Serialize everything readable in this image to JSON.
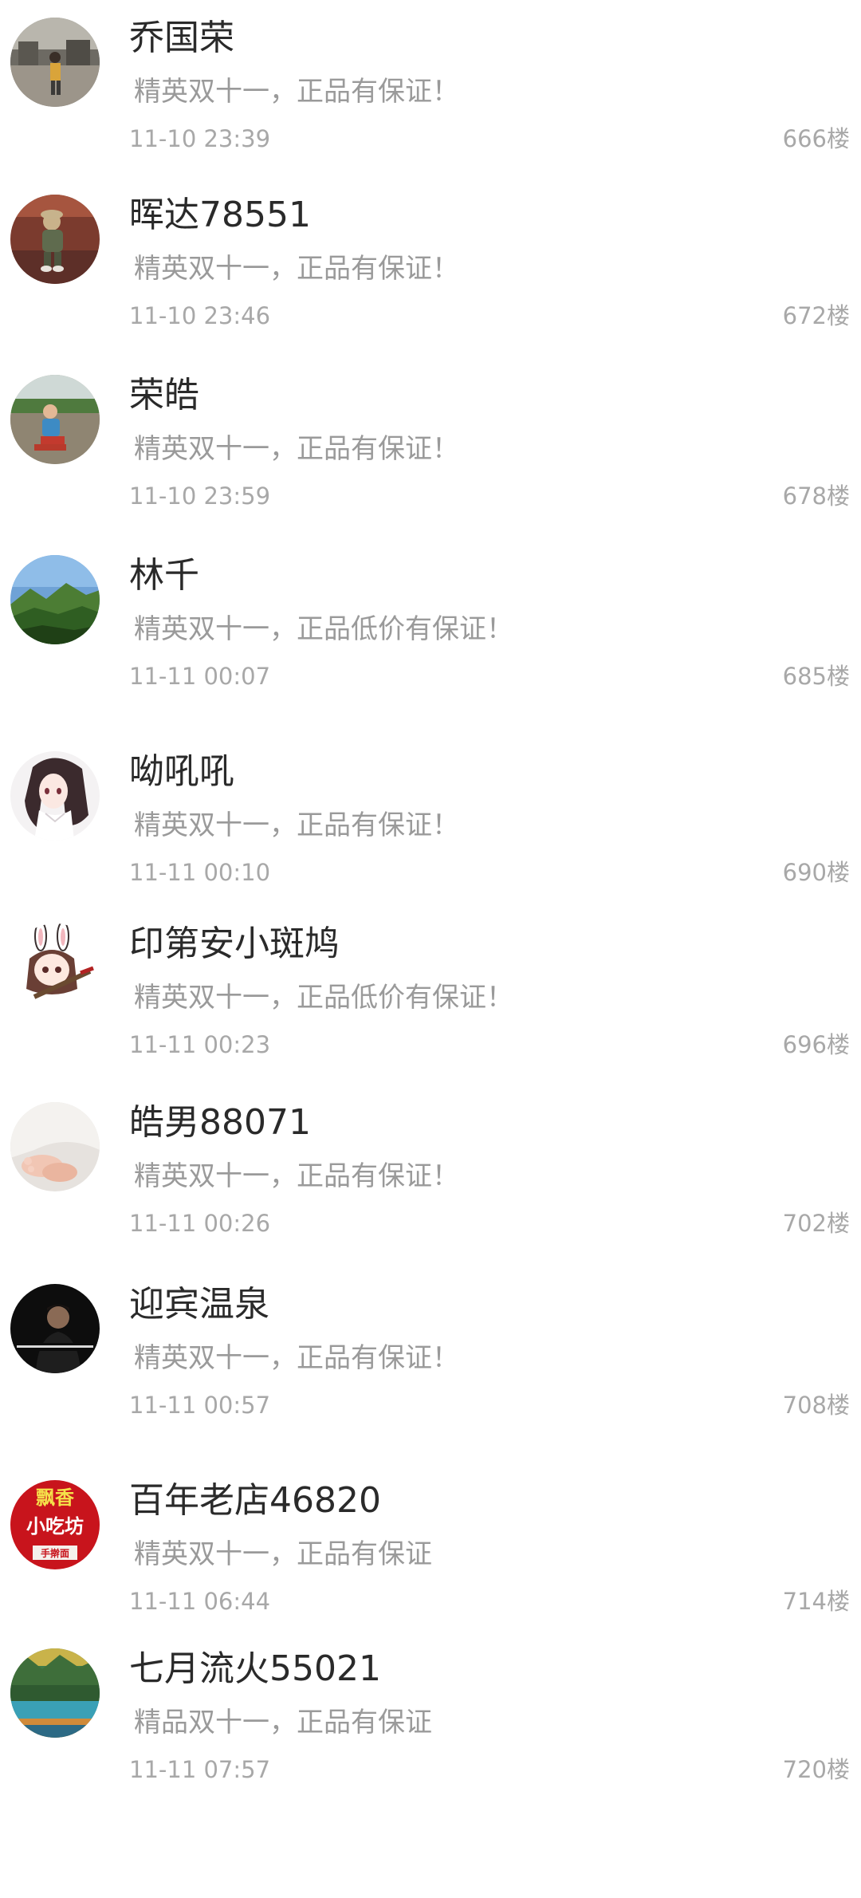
{
  "comments": [
    {
      "username": "乔国荣",
      "content": "精英双十一，正品有保证！",
      "time": "11-10 23:39",
      "floor": "666楼",
      "avatar": "person-standing-photo"
    },
    {
      "username": "晖达78551",
      "content": "精英双十一，正品有保证！",
      "time": "11-10 23:46",
      "floor": "672楼",
      "avatar": "child-photo"
    },
    {
      "username": "荣皓",
      "content": "精英双十一，正品有保证！",
      "time": "11-10 23:59",
      "floor": "678楼",
      "avatar": "child-outdoor-photo"
    },
    {
      "username": "林千",
      "content": "精英双十一，正品低价有保证！",
      "time": "11-11 00:07",
      "floor": "685楼",
      "avatar": "mountain-landscape"
    },
    {
      "username": "呦吼吼",
      "content": "精英双十一，正品有保证！",
      "time": "11-11 00:10",
      "floor": "690楼",
      "avatar": "anime-girl"
    },
    {
      "username": "印第安小斑鸠",
      "content": "精英双十一，正品低价有保证！",
      "time": "11-11 00:23",
      "floor": "696楼",
      "avatar": "cartoon-bunny-girl"
    },
    {
      "username": "皓男88071",
      "content": "精英双十一，正品有保证！",
      "time": "11-11 00:26",
      "floor": "702楼",
      "avatar": "baby-feet"
    },
    {
      "username": "迎宾温泉",
      "content": "精英双十一，正品有保证！",
      "time": "11-11 00:57",
      "floor": "708楼",
      "avatar": "man-portrait-dark"
    },
    {
      "username": "百年老店46820",
      "content": "精英双十一，正品有保证",
      "time": "11-11 06:44",
      "floor": "714楼",
      "avatar": "red-shop-sign",
      "avatar_text": [
        "飘香",
        "小吃坊",
        "手擀面"
      ]
    },
    {
      "username": "七月流火55021",
      "content": "精品双十一，正品有保证",
      "time": "11-11 07:57",
      "floor": "720楼",
      "avatar": "lake-landscape"
    }
  ]
}
